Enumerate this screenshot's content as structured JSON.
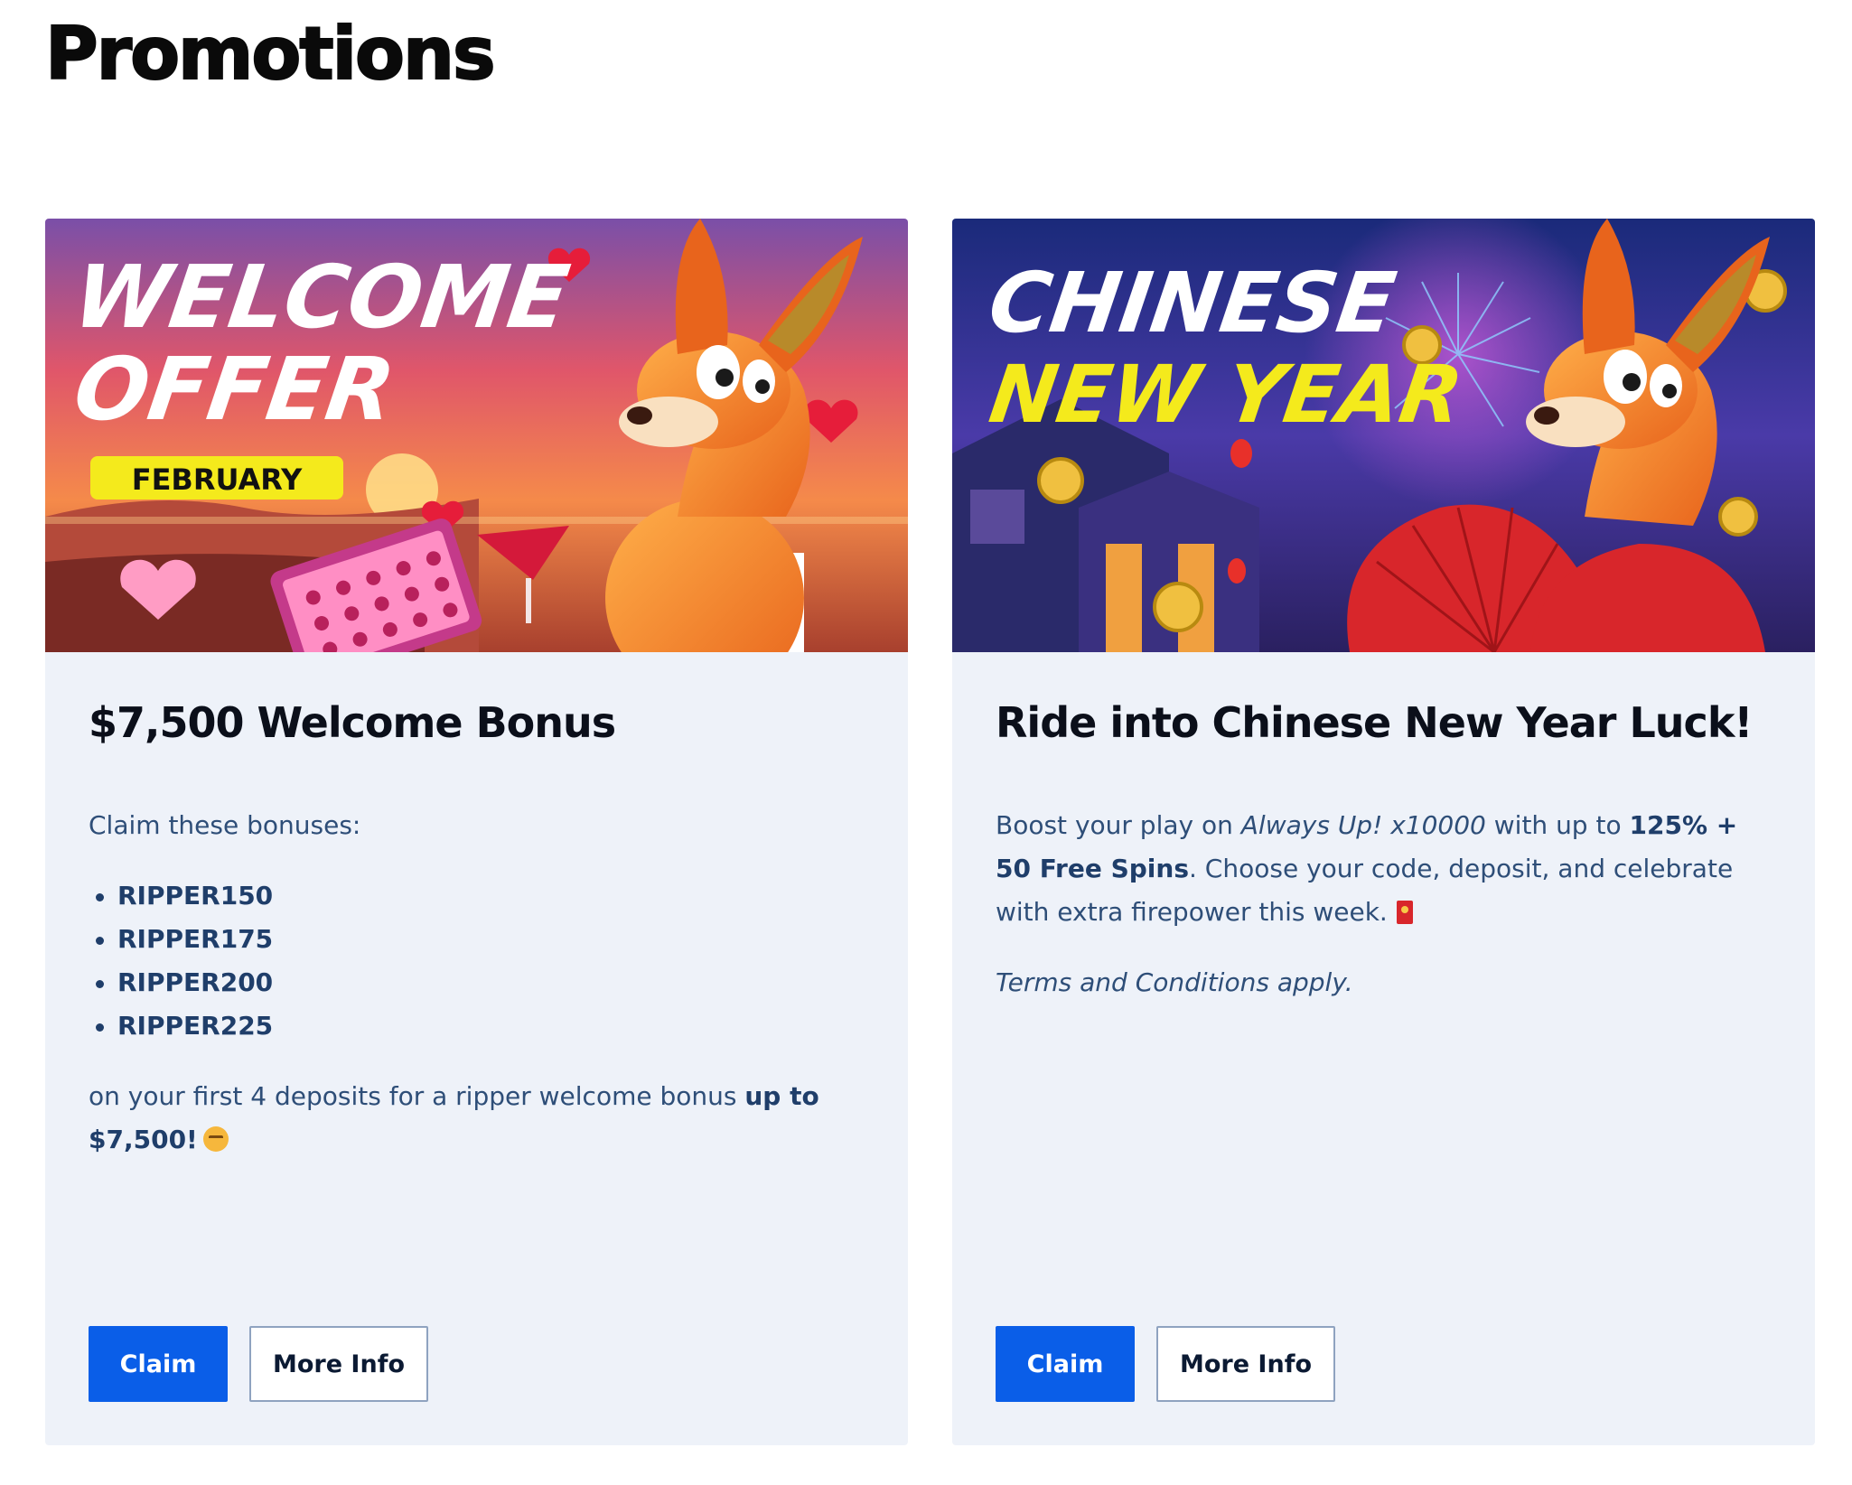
{
  "page": {
    "title": "Promotions"
  },
  "colors": {
    "primary_button": "#0a5ee8",
    "card_background": "#eef2f9",
    "body_text": "#2e4e78",
    "heading_text": "#0b0f1a"
  },
  "promotions": [
    {
      "banner": {
        "headline_line1": "WELCOME",
        "headline_line2": "OFFER",
        "badge": "FEBRUARY"
      },
      "title": "$7,500 Welcome Bonus",
      "intro": "Claim these bonuses:",
      "codes": [
        "RIPPER150",
        "RIPPER175",
        "RIPPER200",
        "RIPPER225"
      ],
      "outro_prefix": "on your first 4 deposits for a ripper welcome bonus ",
      "outro_bold": "up to $7,500!",
      "outro_emoji": "exploding-head-emoji",
      "claim_label": "Claim",
      "more_info_label": "More Info"
    },
    {
      "banner": {
        "headline_line1": "CHINESE",
        "headline_line2": "NEW YEAR"
      },
      "title": "Ride into Chinese New Year Luck!",
      "text_prefix": "Boost your play on ",
      "text_game": "Always Up! x10000",
      "text_mid": " with up to ",
      "text_bold": "125% + 50 Free Spins",
      "text_suffix": ". Choose your code, deposit, and celebrate with extra firepower this week.",
      "text_emoji": "red-envelope-emoji",
      "terms": "Terms and Conditions apply.",
      "claim_label": "Claim",
      "more_info_label": "More Info"
    }
  ]
}
